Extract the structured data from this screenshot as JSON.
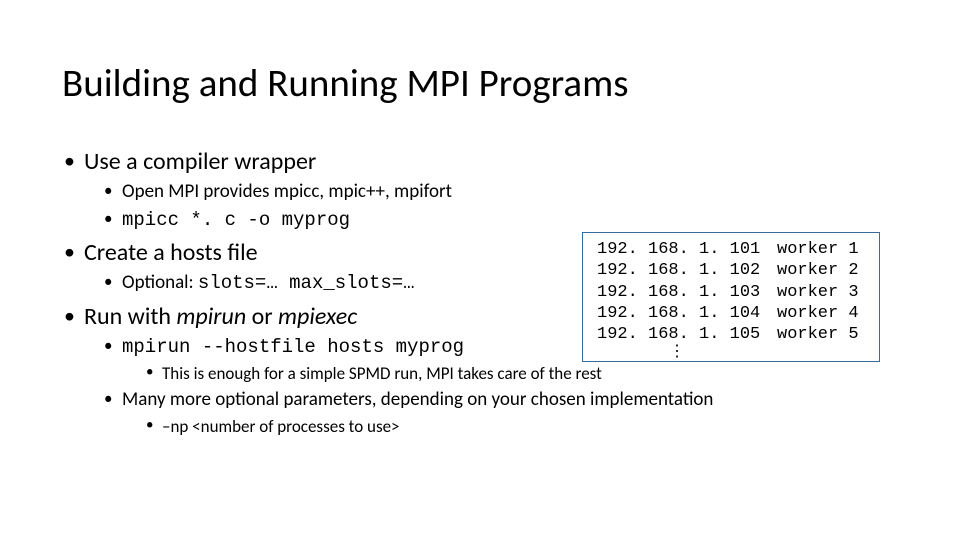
{
  "title": "Building and Running MPI Programs",
  "bullets": {
    "l1_1": "Use a compiler wrapper",
    "l2_1a": "Open MPI provides mpicc, mpic++, mpifort",
    "l2_1b": "mpicc *. c -o myprog",
    "l1_2": "Create a hosts file",
    "l2_2a_pre": "Optional: ",
    "l2_2a_code": "slots=…  max_slots=…",
    "l1_3_pre": "Run with ",
    "l1_3_it1": "mpirun",
    "l1_3_mid": " or ",
    "l1_3_it2": "mpiexec",
    "l2_3a": "mpirun --hostfile hosts myprog",
    "l3_3a1": "This is enough for a simple SPMD run, MPI takes care of the rest",
    "l2_3b": "Many more optional parameters, depending on your chosen implementation",
    "l3_3b1": "–np <number of processes to use>"
  },
  "hosts": [
    {
      "ip": "192. 168. 1. 101",
      "name": "worker 1"
    },
    {
      "ip": "192. 168. 1. 102",
      "name": "worker 2"
    },
    {
      "ip": "192. 168. 1. 103",
      "name": "worker 3"
    },
    {
      "ip": "192. 168. 1. 104",
      "name": "worker 4"
    },
    {
      "ip": "192. 168. 1. 105",
      "name": "worker 5"
    }
  ],
  "hosts_ellipsis": "⋮"
}
